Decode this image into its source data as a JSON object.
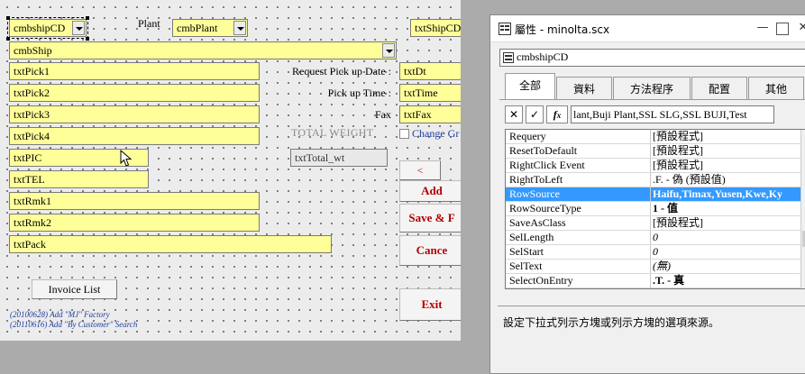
{
  "form": {
    "controls": {
      "cmbshipcd": "cmbshipCD",
      "plant_label": "Plant",
      "cmbplant": "cmbPlant",
      "txtshipcd": "txtShipCD",
      "cmbship": "cmbShip",
      "txtpick1": "txtPick1",
      "txtpick2": "txtPick2",
      "txtpick3": "txtPick3",
      "txtpick4": "txtPick4",
      "txtpic": "txtPIC",
      "txttel": "txtTEL",
      "txtrmk1": "txtRmk1",
      "txtrmk2": "txtRmk2",
      "txtpack": "txtPack",
      "request_pickup_label": "Request Pick up Date :",
      "pickup_time_label": "Pick up Time :",
      "fax_label": "Fax",
      "txtdt": "txtDt",
      "txttime": "txtTime",
      "txtfax": "txtFax",
      "total_weight_label": "TOTAL WEIGHT",
      "txttotal_wt": "txtTotal_wt",
      "change_label": "Change Gr",
      "prev_button": "<",
      "add_button": "Add",
      "save_button": "Save & F",
      "cancel_button": "Cance",
      "exit_button": "Exit",
      "invoice_list_button": "Invoice List"
    },
    "notes": [
      "(20100628) Add \"MJ\" Factory",
      "(20110616) Add \"By Customer\" Search"
    ]
  },
  "properties": {
    "title": "屬性 - minolta.scx",
    "object_selector": "cmbshipCD",
    "tabs": [
      "全部",
      "資料",
      "方法程序",
      "配置",
      "其他"
    ],
    "active_tab": "全部",
    "edit_value": "lant,Buji Plant,SSL SLG,SSL BUJI,Test",
    "rows": [
      {
        "name": "Requery",
        "value": "[預設程式]",
        "style": ""
      },
      {
        "name": "ResetToDefault",
        "value": "[預設程式]",
        "style": ""
      },
      {
        "name": "RightClick Event",
        "value": "[預設程式]",
        "style": ""
      },
      {
        "name": "RightToLeft",
        "value": ".F. - 偽 (預設值)",
        "style": ""
      },
      {
        "name": "RowSource",
        "value": "Haifu,Timax,Yusen,Kwe,Ky",
        "style": "hl"
      },
      {
        "name": "RowSourceType",
        "value": "1 - 值",
        "style": "bold"
      },
      {
        "name": "SaveAsClass",
        "value": "[預設程式]",
        "style": ""
      },
      {
        "name": "SelLength",
        "value": "0",
        "style": "it"
      },
      {
        "name": "SelStart",
        "value": "0",
        "style": "it"
      },
      {
        "name": "SelText",
        "value": "(無)",
        "style": "it"
      },
      {
        "name": "SelectOnEntry",
        "value": ".T. - 真",
        "style": "bold"
      }
    ],
    "description": "設定下拉式列示方塊或列示方塊的選項來源。"
  },
  "colors": {
    "control_fill": "#ffff99",
    "selection": "#3399ff",
    "button_text": "#b30000"
  }
}
